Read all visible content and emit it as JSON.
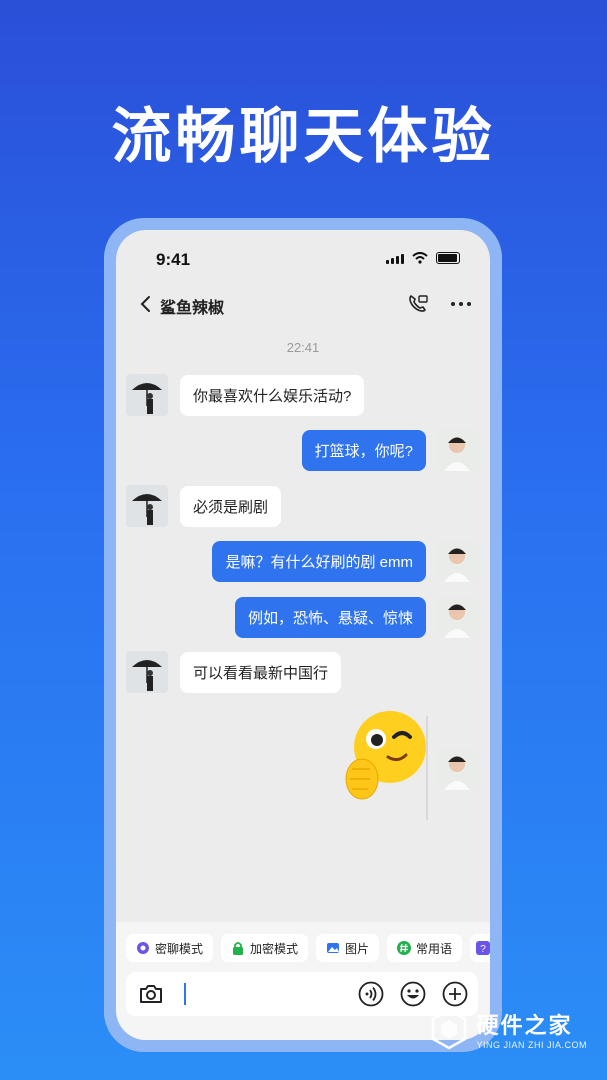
{
  "headline": "流畅聊天体验",
  "status_bar": {
    "time": "9:41"
  },
  "chat_header": {
    "contact_name": "鲨鱼辣椒"
  },
  "timestamp": "22:41",
  "messages": [
    {
      "side": "left",
      "text": "你最喜欢什么娱乐活动?"
    },
    {
      "side": "right",
      "text": "打篮球，你呢?"
    },
    {
      "side": "left",
      "text": "必须是刷剧"
    },
    {
      "side": "right",
      "text": "是嘛？有什么好刷的剧 emm"
    },
    {
      "side": "right",
      "text": "例如，恐怖、悬疑、惊悚"
    },
    {
      "side": "left",
      "text": "可以看看最新中国行"
    }
  ],
  "sticker": {
    "icon": "winking-face-sticker"
  },
  "quick_actions": [
    {
      "label": "密聊模式",
      "icon": "secret-chat-icon",
      "color": "#6a55e8"
    },
    {
      "label": "加密模式",
      "icon": "lock-icon",
      "color": "#22b24c"
    },
    {
      "label": "图片",
      "icon": "image-icon",
      "color": "#2f74ee"
    },
    {
      "label": "常用语",
      "icon": "hashtag-icon",
      "color": "#22b24c"
    }
  ],
  "input_bar": {
    "value": ""
  },
  "watermark": {
    "title": "硬件之家",
    "subtitle": "YING JIAN ZHI JIA.COM"
  },
  "colors": {
    "accent": "#2f74ee",
    "background_top": "#2a4fd8",
    "background_bottom": "#2b8ef6"
  }
}
